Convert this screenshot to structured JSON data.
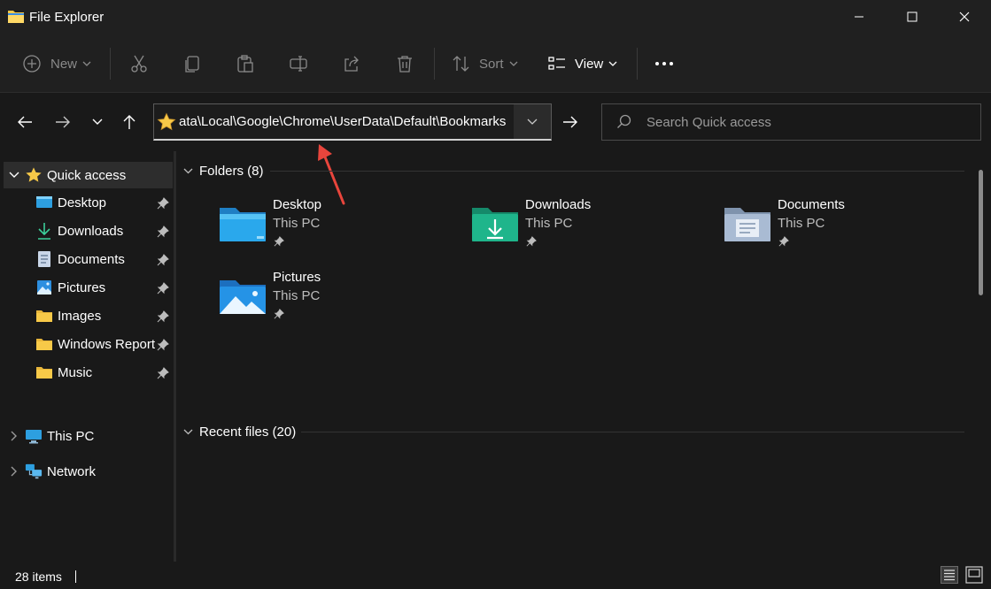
{
  "window": {
    "title": "File Explorer"
  },
  "toolbar": {
    "new_label": "New",
    "sort_label": "Sort",
    "view_label": "View"
  },
  "address": {
    "path": "ata\\Local\\Google\\Chrome\\UserData\\Default\\Bookmarks"
  },
  "search": {
    "placeholder": "Search Quick access"
  },
  "sidebar": {
    "quick_access": "Quick access",
    "items": [
      {
        "label": "Desktop"
      },
      {
        "label": "Downloads"
      },
      {
        "label": "Documents"
      },
      {
        "label": "Pictures"
      },
      {
        "label": "Images"
      },
      {
        "label": "Windows Report"
      },
      {
        "label": "Music"
      }
    ],
    "this_pc": "This PC",
    "network": "Network"
  },
  "content": {
    "folders_header": "Folders (8)",
    "recent_header": "Recent files (20)",
    "folders": [
      {
        "name": "Desktop",
        "location": "This PC"
      },
      {
        "name": "Downloads",
        "location": "This PC"
      },
      {
        "name": "Documents",
        "location": "This PC"
      },
      {
        "name": "Pictures",
        "location": "This PC"
      }
    ]
  },
  "status": {
    "items": "28 items"
  },
  "colors": {
    "accent": "#4cc2ff",
    "folder_yellow": "#f7c948",
    "annotation_arrow": "#e8453c"
  }
}
